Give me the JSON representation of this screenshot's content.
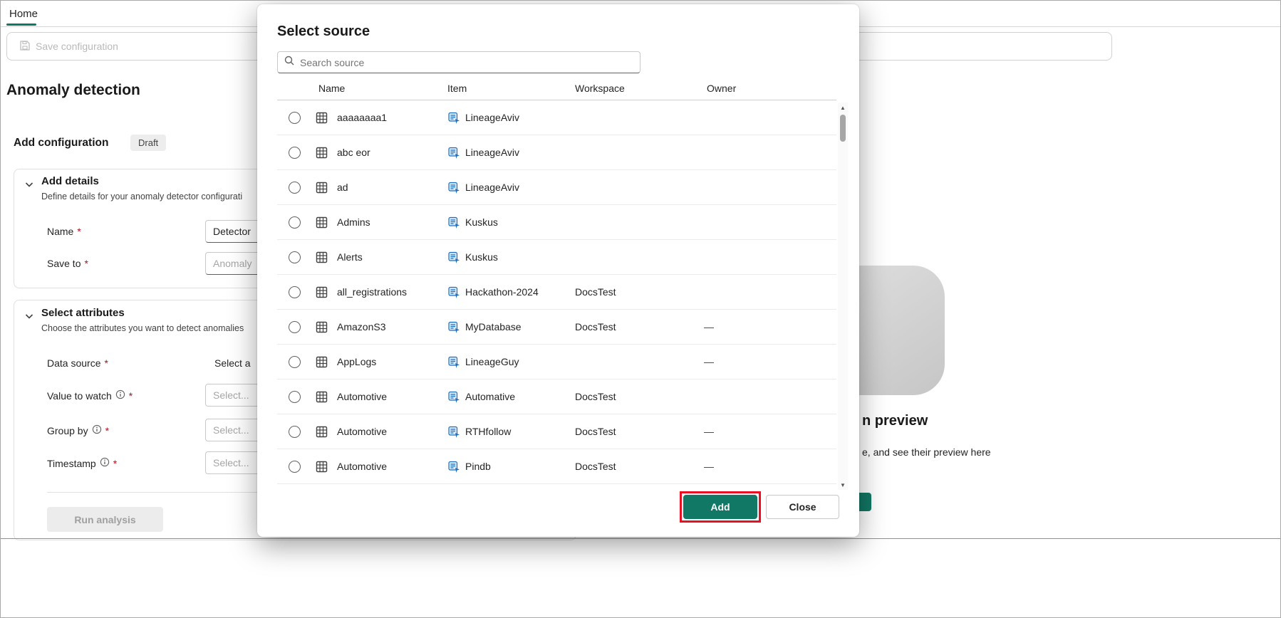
{
  "colors": {
    "accent": "#117865",
    "annotation": "#e81123"
  },
  "topbar": {
    "home_tab": "Home",
    "save_button": "Save configuration"
  },
  "page": {
    "title": "Anomaly detection",
    "config_heading": "Add configuration",
    "draft_badge": "Draft",
    "required_mark": "*",
    "add_details": {
      "title": "Add details",
      "subtitle": "Define details for your anomaly detector configurati",
      "name_label": "Name",
      "name_value": "Detector",
      "save_to_label": "Save to",
      "save_to_placeholder": "Anomaly"
    },
    "select_attributes": {
      "title": "Select attributes",
      "subtitle": "Choose the attributes you want to detect anomalies",
      "data_source_label": "Data source",
      "data_source_value": "Select a",
      "value_to_watch_label": "Value to watch",
      "group_by_label": "Group by",
      "timestamp_label": "Timestamp",
      "select_placeholder": "Select..."
    },
    "run_analysis_button": "Run analysis",
    "preview_fragment": {
      "heading": "n preview",
      "body": "e, and see their preview here"
    }
  },
  "dialog": {
    "title": "Select source",
    "search_placeholder": "Search source",
    "columns": {
      "name": "Name",
      "item": "Item",
      "workspace": "Workspace",
      "owner": "Owner"
    },
    "rows": [
      {
        "name": "aaaaaaaa1",
        "item": "LineageAviv",
        "workspace": "",
        "owner": ""
      },
      {
        "name": "abc eor",
        "item": "LineageAviv",
        "workspace": "",
        "owner": ""
      },
      {
        "name": "ad",
        "item": "LineageAviv",
        "workspace": "",
        "owner": ""
      },
      {
        "name": "Admins",
        "item": "Kuskus",
        "workspace": "",
        "owner": ""
      },
      {
        "name": "Alerts",
        "item": "Kuskus",
        "workspace": "",
        "owner": ""
      },
      {
        "name": "all_registrations",
        "item": "Hackathon-2024",
        "workspace": "DocsTest",
        "owner": ""
      },
      {
        "name": "AmazonS3",
        "item": "MyDatabase",
        "workspace": "DocsTest",
        "owner": "—"
      },
      {
        "name": "AppLogs",
        "item": "LineageGuy",
        "workspace": "",
        "owner": "—"
      },
      {
        "name": "Automotive",
        "item": "Automative",
        "workspace": "DocsTest",
        "owner": ""
      },
      {
        "name": "Automotive",
        "item": "RTHfollow",
        "workspace": "DocsTest",
        "owner": "—"
      },
      {
        "name": "Automotive",
        "item": "Pindb",
        "workspace": "DocsTest",
        "owner": "—"
      }
    ],
    "add_button": "Add",
    "close_button": "Close"
  }
}
